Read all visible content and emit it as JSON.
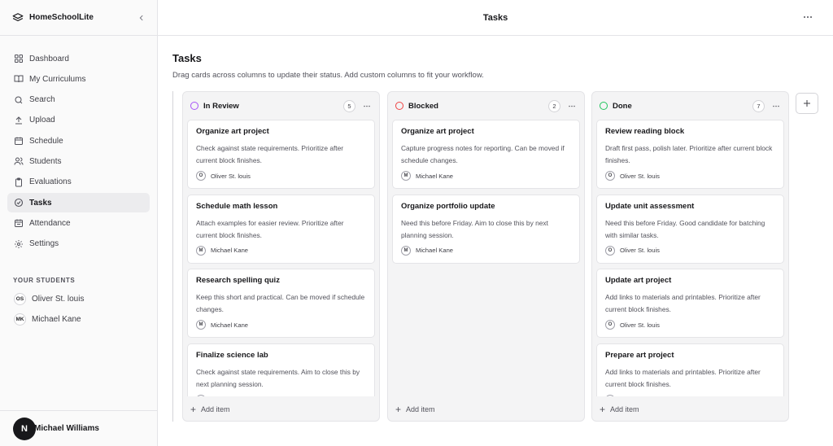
{
  "app": {
    "name": "HomeSchoolLite"
  },
  "topbar": {
    "title": "Tasks"
  },
  "sidebar": {
    "items": [
      {
        "label": "Dashboard",
        "icon": "grid-icon",
        "active": false
      },
      {
        "label": "My Curriculums",
        "icon": "book-icon",
        "active": false
      },
      {
        "label": "Search",
        "icon": "search-icon",
        "active": false
      },
      {
        "label": "Upload",
        "icon": "upload-icon",
        "active": false
      },
      {
        "label": "Schedule",
        "icon": "calendar-icon",
        "active": false
      },
      {
        "label": "Students",
        "icon": "users-icon",
        "active": false
      },
      {
        "label": "Evaluations",
        "icon": "clipboard-icon",
        "active": false
      },
      {
        "label": "Tasks",
        "icon": "check-circle-icon",
        "active": true
      },
      {
        "label": "Attendance",
        "icon": "calendar-check-icon",
        "active": false
      },
      {
        "label": "Settings",
        "icon": "gear-icon",
        "active": false
      }
    ],
    "students_label": "YOUR STUDENTS",
    "students": [
      {
        "initials": "OS",
        "name": "Oliver St. louis"
      },
      {
        "initials": "MK",
        "name": "Michael Kane"
      }
    ],
    "user": {
      "initial": "N",
      "name": "Michael Williams"
    }
  },
  "page": {
    "title": "Tasks",
    "description": "Drag cards across columns to update their status. Add custom columns to fit your workflow."
  },
  "columns": [
    {
      "title": "In Review",
      "count": "5",
      "color": "#a855f7",
      "add_label": "Add item",
      "cards": [
        {
          "title": "Organize art project",
          "desc": "Check against state requirements. Prioritize after current block finishes.",
          "initial": "O",
          "assignee": "Oliver St. louis"
        },
        {
          "title": "Schedule math lesson",
          "desc": "Attach examples for easier review. Prioritize after current block finishes.",
          "initial": "M",
          "assignee": "Michael Kane"
        },
        {
          "title": "Research spelling quiz",
          "desc": "Keep this short and practical. Can be moved if schedule changes.",
          "initial": "M",
          "assignee": "Michael Kane"
        },
        {
          "title": "Finalize science lab",
          "desc": "Check against state requirements. Aim to close this by next planning session.",
          "initial": "O",
          "assignee": "Oliver St. louis"
        }
      ]
    },
    {
      "title": "Blocked",
      "count": "2",
      "color": "#ef4444",
      "add_label": "Add item",
      "cards": [
        {
          "title": "Organize art project",
          "desc": "Capture progress notes for reporting. Can be moved if schedule changes.",
          "initial": "M",
          "assignee": "Michael Kane"
        },
        {
          "title": "Organize portfolio update",
          "desc": "Need this before Friday. Aim to close this by next planning session.",
          "initial": "M",
          "assignee": "Michael Kane"
        }
      ]
    },
    {
      "title": "Done",
      "count": "7",
      "color": "#22c55e",
      "add_label": "Add item",
      "cards": [
        {
          "title": "Review reading block",
          "desc": "Draft first pass, polish later. Prioritize after current block finishes.",
          "initial": "O",
          "assignee": "Oliver St. louis"
        },
        {
          "title": "Update unit assessment",
          "desc": "Need this before Friday. Good candidate for batching with similar tasks.",
          "initial": "O",
          "assignee": "Oliver St. louis"
        },
        {
          "title": "Update art project",
          "desc": "Add links to materials and printables. Prioritize after current block finishes.",
          "initial": "O",
          "assignee": "Oliver St. louis"
        },
        {
          "title": "Prepare art project",
          "desc": "Add links to materials and printables. Prioritize after current block finishes.",
          "initial": "O",
          "assignee": "Oliver St. louis"
        }
      ]
    }
  ]
}
